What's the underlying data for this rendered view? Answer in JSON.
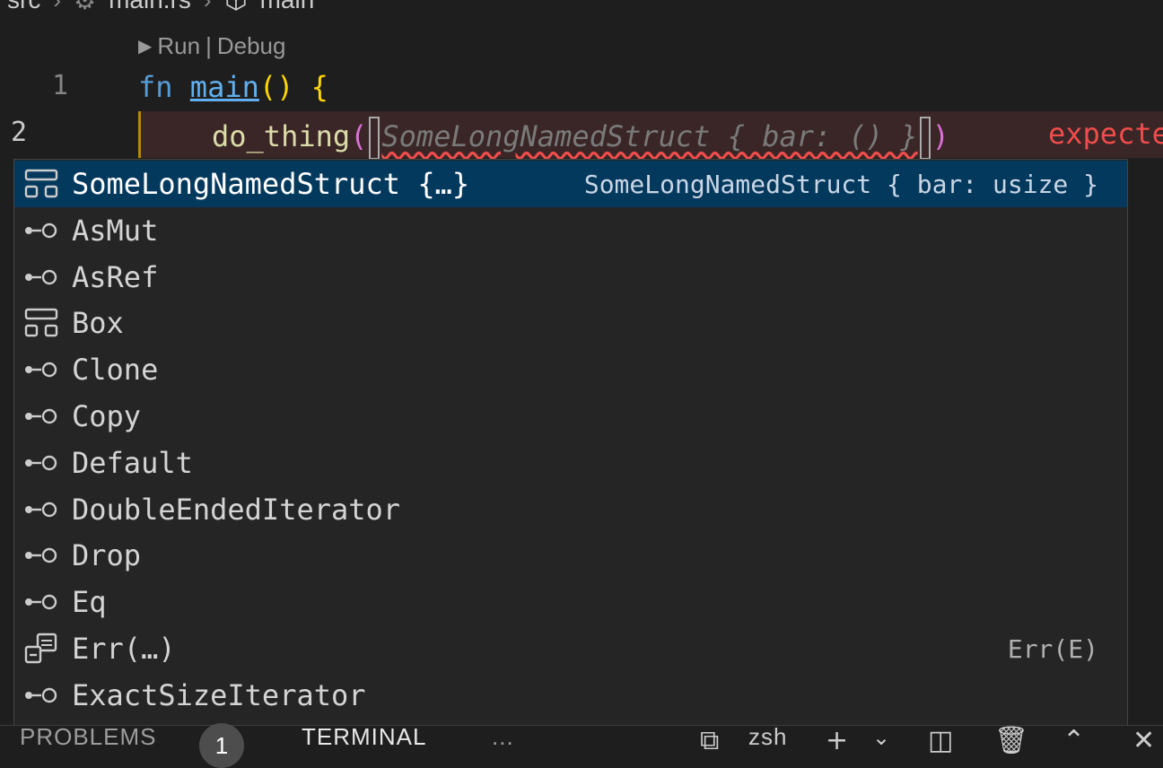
{
  "breadcrumb": {
    "folder": "src",
    "file": "main.rs",
    "symbol": "main"
  },
  "codelens": {
    "run": "Run",
    "sep": "|",
    "debug": "Debug"
  },
  "editor": {
    "line1_number": "1",
    "line2_number": "2",
    "line1": {
      "kw": "fn",
      "name": "main",
      "parens": "()",
      "brace": "{"
    },
    "line2": {
      "call": "do_thing",
      "open": "(",
      "ghost": "SomeLongNamedStruct { bar: () }",
      "close": ")"
    },
    "diagnostic": "expecte"
  },
  "suggest": {
    "items": [
      {
        "icon": "struct-icon",
        "label": "SomeLongNamedStruct {…}",
        "detail": "SomeLongNamedStruct { bar: usize }",
        "selected": true
      },
      {
        "icon": "interface-icon",
        "label": "AsMut",
        "detail": ""
      },
      {
        "icon": "interface-icon",
        "label": "AsRef",
        "detail": ""
      },
      {
        "icon": "struct-icon",
        "label": "Box",
        "detail": ""
      },
      {
        "icon": "interface-icon",
        "label": "Clone",
        "detail": ""
      },
      {
        "icon": "interface-icon",
        "label": "Copy",
        "detail": ""
      },
      {
        "icon": "interface-icon",
        "label": "Default",
        "detail": ""
      },
      {
        "icon": "interface-icon",
        "label": "DoubleEndedIterator",
        "detail": ""
      },
      {
        "icon": "interface-icon",
        "label": "Drop",
        "detail": ""
      },
      {
        "icon": "interface-icon",
        "label": "Eq",
        "detail": ""
      },
      {
        "icon": "enum-member-icon",
        "label": "Err(…)",
        "detail": "Err(E)"
      },
      {
        "icon": "interface-icon",
        "label": "ExactSizeIterator",
        "detail": ""
      }
    ]
  },
  "panel": {
    "problems_label": "PROBLEMS",
    "problems_count": "1",
    "terminal_label": "TERMINAL",
    "more_label": "...",
    "shell": "zsh"
  }
}
